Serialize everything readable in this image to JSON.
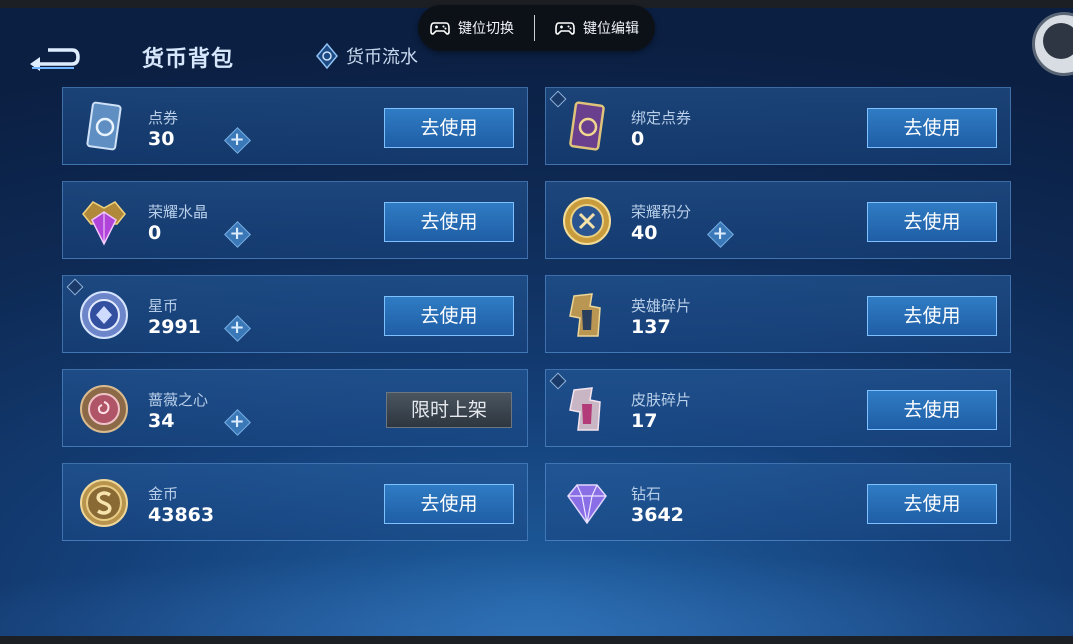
{
  "header": {
    "title": "货币背包",
    "flow_tab": "货币流水"
  },
  "overlay": {
    "key_switch": "键位切换",
    "key_edit": "键位编辑"
  },
  "currencies": [
    {
      "name": "点券",
      "value": "30",
      "button": "去使用",
      "icon": "voucher-card-icon"
    },
    {
      "name": "绑定点券",
      "value": "0",
      "button": "去使用",
      "icon": "bound-voucher-card-icon"
    },
    {
      "name": "荣耀水晶",
      "value": "0",
      "button": "去使用",
      "icon": "glory-crystal-icon"
    },
    {
      "name": "荣耀积分",
      "value": "40",
      "button": "去使用",
      "icon": "glory-points-coin-icon"
    },
    {
      "name": "星币",
      "value": "2991",
      "button": "去使用",
      "icon": "star-coin-icon"
    },
    {
      "name": "英雄碎片",
      "value": "137",
      "button": "去使用",
      "icon": "hero-fragment-icon"
    },
    {
      "name": "蔷薇之心",
      "value": "34",
      "button": "限时上架",
      "icon": "rose-heart-icon"
    },
    {
      "name": "皮肤碎片",
      "value": "17",
      "button": "去使用",
      "icon": "skin-fragment-icon"
    },
    {
      "name": "金币",
      "value": "43863",
      "button": "去使用",
      "icon": "gold-coin-icon"
    },
    {
      "name": "钻石",
      "value": "3642",
      "button": "去使用",
      "icon": "diamond-icon"
    }
  ],
  "colors": {
    "accent": "#2f7cc4",
    "background": "#143f78"
  }
}
